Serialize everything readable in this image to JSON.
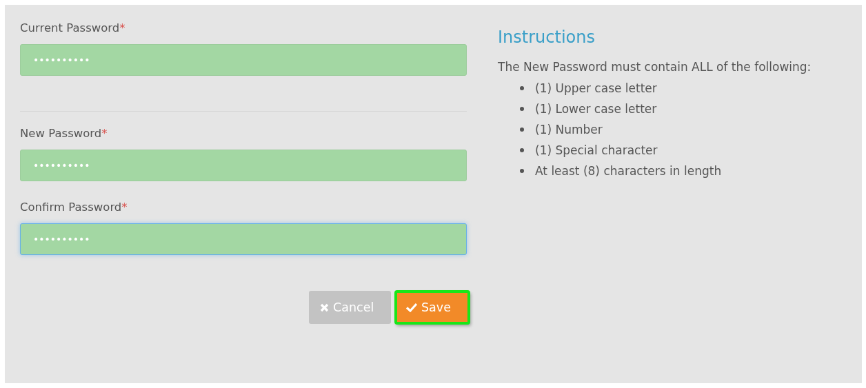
{
  "form": {
    "sections": [
      {
        "fields": [
          {
            "label": "Current Password",
            "required_mark": "*",
            "value": "••••••••••",
            "focused": false
          }
        ]
      },
      {
        "fields": [
          {
            "label": "New Password",
            "required_mark": "*",
            "value": "••••••••••",
            "focused": false
          },
          {
            "label": "Confirm Password",
            "required_mark": "*",
            "value": "••••••••••",
            "focused": true
          }
        ]
      }
    ],
    "buttons": [
      {
        "kind": "cancel",
        "label": "Cancel",
        "highlighted": false
      },
      {
        "kind": "save",
        "label": "Save",
        "highlighted": true
      }
    ]
  },
  "instructions": {
    "title": "Instructions",
    "intro": "The New Password must contain ALL of the following:",
    "items": [
      "(1) Upper case letter",
      "(1) Lower case letter",
      "(1) Number",
      "(1) Special character",
      "At least (8) characters in length"
    ]
  }
}
